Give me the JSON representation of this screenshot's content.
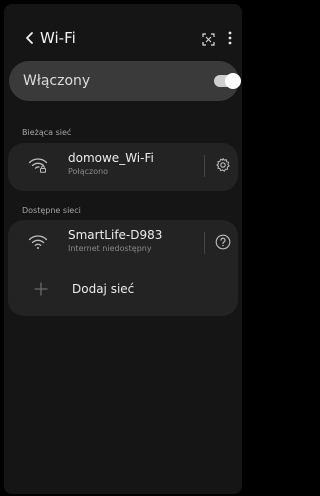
{
  "header": {
    "title": "Wi-Fi",
    "back_icon": "chevron-left-icon",
    "qr_icon": "qr-scan-icon",
    "more_icon": "more-vertical-icon"
  },
  "toggle": {
    "label": "Włączony",
    "state": "on"
  },
  "current_network": {
    "section_label": "Bieżąca sieć",
    "name": "domowe_Wi-Fi",
    "status": "Połączono",
    "icon": "wifi-lock-icon",
    "action_icon": "gear-icon"
  },
  "available_networks": {
    "section_label": "Dostępne sieci",
    "items": [
      {
        "name": "SmartLife-D983",
        "status": "Internet niedostępny",
        "icon": "wifi-icon",
        "action_icon": "question-icon"
      }
    ],
    "add_label": "Dodaj sieć",
    "add_icon": "plus-icon"
  },
  "colors": {
    "background": "#151515",
    "card": "#232323",
    "toggle_card": "#3a3a3a",
    "text_primary": "#ececec",
    "text_secondary": "#8a8a8a"
  }
}
